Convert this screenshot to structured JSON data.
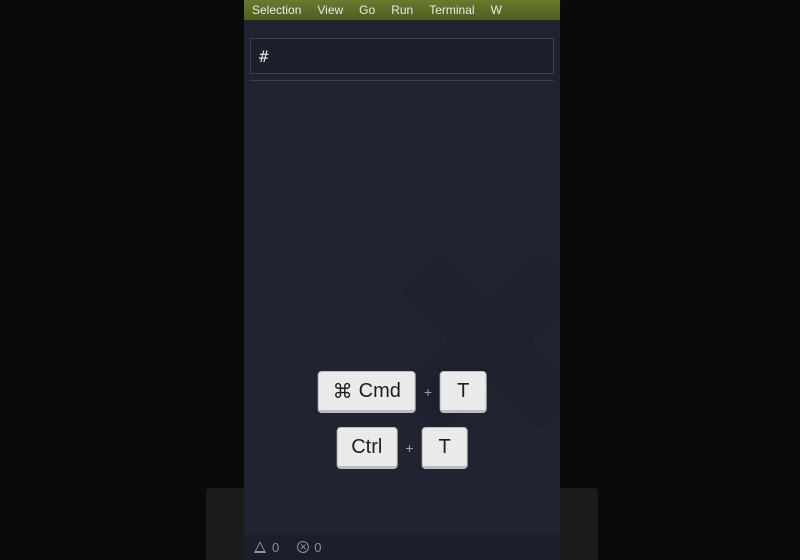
{
  "menubar": {
    "items": [
      "Selection",
      "View",
      "Go",
      "Run",
      "Terminal",
      "W"
    ]
  },
  "search": {
    "value": "#",
    "placeholder": ""
  },
  "shortcuts": {
    "row1": {
      "mod_glyph": "⌘",
      "mod_label": "Cmd",
      "key": "T"
    },
    "row2": {
      "mod_label": "Ctrl",
      "key": "T"
    }
  },
  "status": {
    "warnings": "0",
    "errors": "0"
  }
}
